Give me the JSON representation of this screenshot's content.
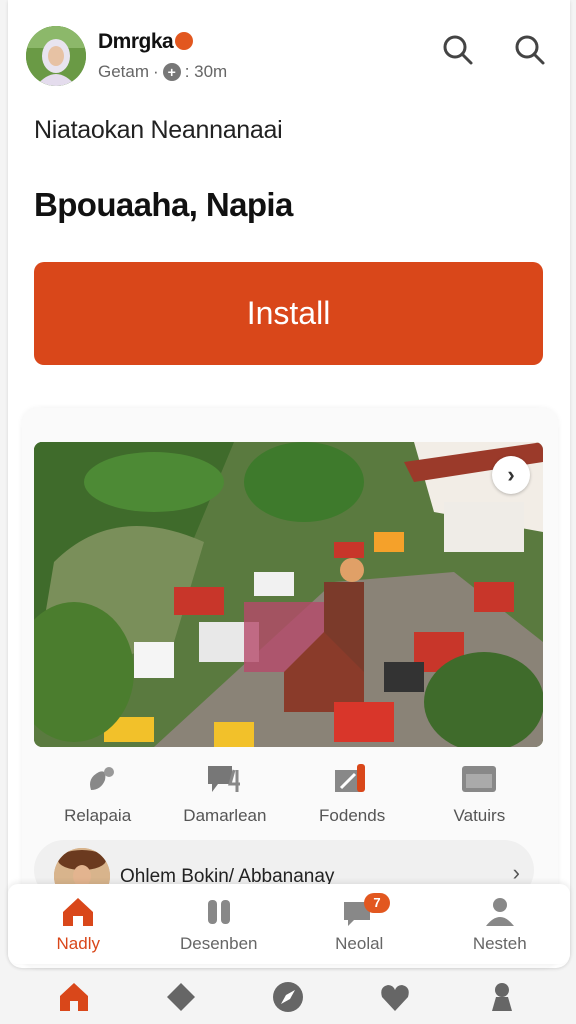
{
  "header": {
    "user_name": "Dmrgka",
    "meta_left": "Getam",
    "meta_right": ": 30m"
  },
  "post": {
    "subtitle": "Niataokan Neannanaai",
    "headline": "Bpouaaha, Napia",
    "install_label": "Install"
  },
  "actions": [
    {
      "label": "Relapaia",
      "icon": "pin-icon"
    },
    {
      "label": "Damarlean",
      "icon": "chat-icon"
    },
    {
      "label": "Fodends",
      "icon": "edit-icon"
    },
    {
      "label": "Vatuirs",
      "icon": "window-icon"
    }
  ],
  "row_item": {
    "text": "Ohlem Bokin/ Abbananay"
  },
  "tabs": [
    {
      "label": "Nadly",
      "icon": "home-icon",
      "active": true
    },
    {
      "label": "Desenben",
      "icon": "feet-icon"
    },
    {
      "label": "Neolal",
      "icon": "message-icon",
      "badge": "7"
    },
    {
      "label": "Nesteh",
      "icon": "person-icon"
    }
  ],
  "system_nav": [
    "home-icon",
    "diamond-icon",
    "compass-icon",
    "heart-icon",
    "profile-icon"
  ],
  "colors": {
    "accent": "#d9471a",
    "badge": "#e2571f"
  }
}
